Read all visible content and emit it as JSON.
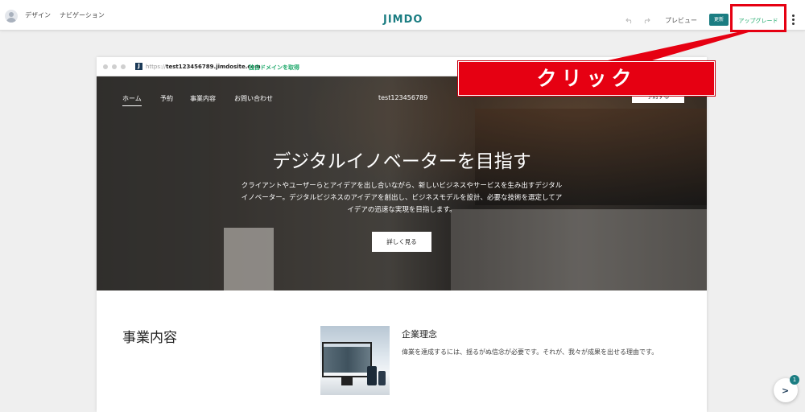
{
  "topbar": {
    "nav": [
      "デザイン",
      "ナビゲーション"
    ],
    "logo": "JIMDO",
    "undo_icon": "undo-icon",
    "redo_icon": "redo-icon",
    "preview": "プレビュー",
    "update": "更新",
    "upgrade": "アップグレード",
    "more_icon": "more-vertical-icon"
  },
  "frame": {
    "url_prefix": "https://",
    "url_host": "test123456789.jimdosite.com",
    "domain_link": "独自ドメインを取得"
  },
  "hero": {
    "nav": [
      "ホーム",
      "予約",
      "事業内容",
      "お問い合わせ"
    ],
    "site_name": "test123456789",
    "reserve_button": "予約する",
    "headline": "デジタルイノベーターを目指す",
    "description": "クライアントやユーザーらとアイデアを出し合いながら、新しいビジネスやサービスを生み出すデジタルイノベーター。デジタルビジネスのアイデアを創出し、ビジネスモデルを設計、必要な技術を選定してアイデアの迅速な実現を目指します。",
    "more_button": "詳しく見る"
  },
  "content": {
    "section_title": "事業内容",
    "sub_title": "企業理念",
    "sub_text": "偉業を達成するには、揺るがぬ信念が必要です。それが、我々が成果を出せる理由です。"
  },
  "callout": {
    "text": "クリック",
    "color": "#e60012"
  },
  "fab": {
    "badge": "1",
    "icon": "chevron-right-icon"
  },
  "colors": {
    "brand": "#1b7d82",
    "accent_green": "#1fa96b",
    "callout_red": "#e60012"
  }
}
